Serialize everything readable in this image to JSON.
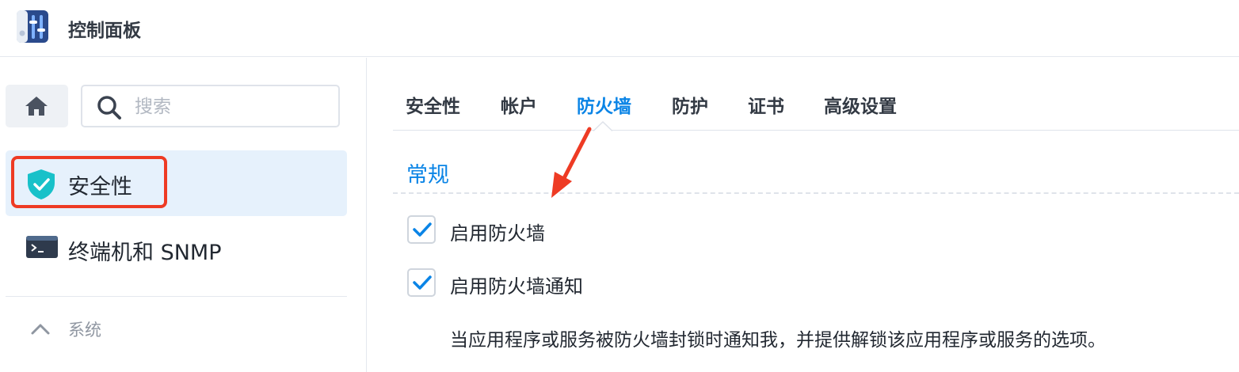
{
  "app": {
    "title": "控制面板",
    "icon": "control-panel-icon"
  },
  "sidebar": {
    "home_icon": "home-icon",
    "search": {
      "placeholder": "搜索",
      "value": "",
      "icon": "search-icon"
    },
    "items": [
      {
        "label": "安全性",
        "icon": "shield-check-icon",
        "active": true
      },
      {
        "label": "终端机和 SNMP",
        "icon": "terminal-icon",
        "active": false
      }
    ],
    "group": {
      "label": "系统",
      "icon": "chevron-up-icon",
      "expanded": true
    }
  },
  "main": {
    "tabs": [
      {
        "label": "安全性",
        "active": false
      },
      {
        "label": "帐户",
        "active": false
      },
      {
        "label": "防火墙",
        "active": true
      },
      {
        "label": "防护",
        "active": false
      },
      {
        "label": "证书",
        "active": false
      },
      {
        "label": "高级设置",
        "active": false
      }
    ],
    "section_title": "常规",
    "options": [
      {
        "label": "启用防火墙",
        "checked": true
      },
      {
        "label": "启用防火墙通知",
        "checked": true
      }
    ],
    "notification_description": "当应用程序或服务被防火墙封锁时通知我，并提供解锁该应用程序或服务的选项。"
  },
  "colors": {
    "accent": "#0a84e6",
    "active_nav_bg": "#e6f1fc",
    "shield": "#18c1c9",
    "highlight": "#ee3b24"
  }
}
